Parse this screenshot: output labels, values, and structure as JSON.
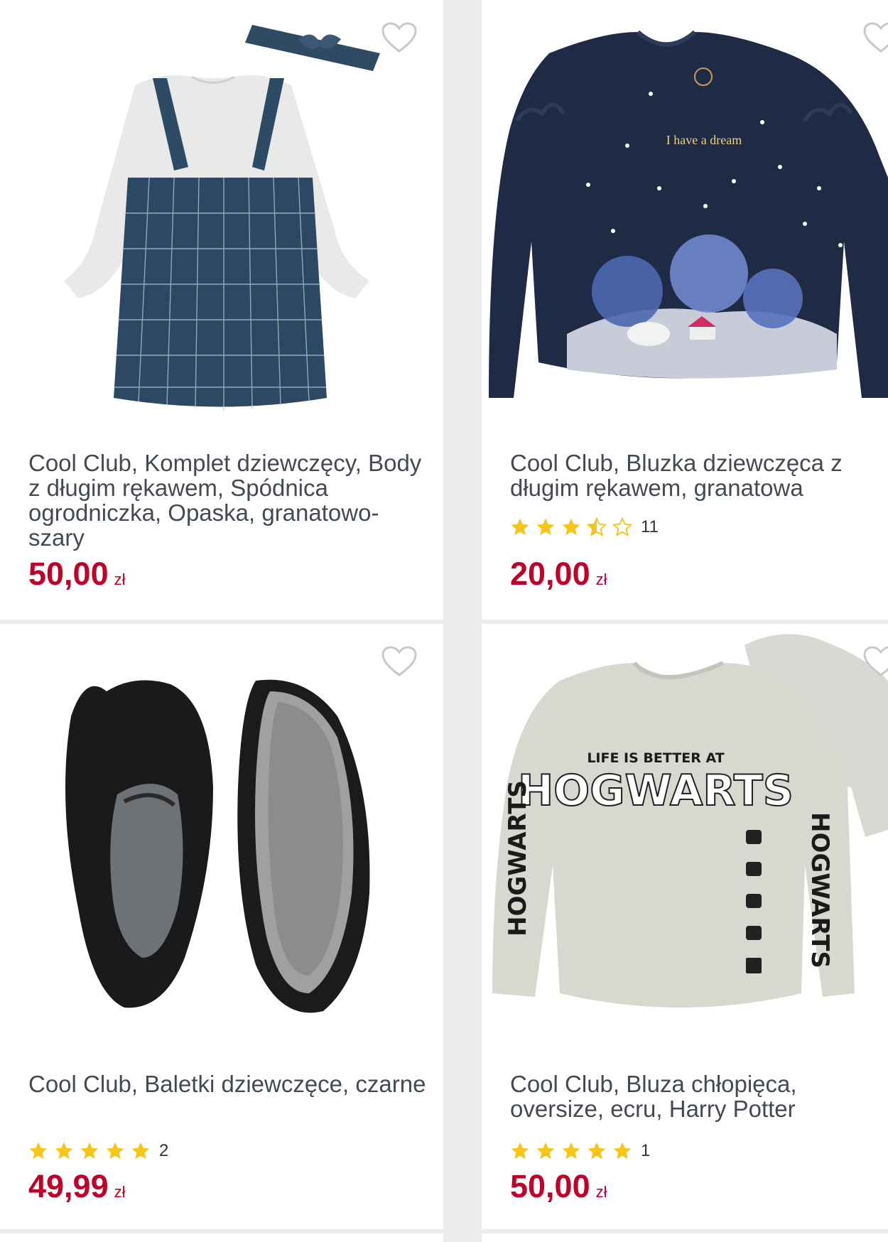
{
  "products": [
    {
      "title": "Cool Club, Komplet dziewczęcy, Body z długim rękawem, Spódnica ogrodniczka, Opaska, granatowo-szary",
      "price": "50,00",
      "currency": "zł",
      "rating": null,
      "review_count": ""
    },
    {
      "title": "Cool Club, Bluzka dziewczęca z długim rękawem, granatowa",
      "price": "20,00",
      "currency": "zł",
      "rating": 3.5,
      "review_count": "11",
      "image_text": "I have a dream"
    },
    {
      "title": "Cool Club, Baletki dziewczęce, czarne",
      "price": "49,99",
      "currency": "zł",
      "rating": 5,
      "review_count": "2"
    },
    {
      "title": "Cool Club, Bluza chłopięca, oversize, ecru, Harry Potter",
      "price": "50,00",
      "currency": "zł",
      "rating": 5,
      "review_count": "1",
      "image_text": {
        "line1": "LIFE IS BETTER AT",
        "line2": "HOGWARTS",
        "sleeve": "HOGWARTS"
      }
    }
  ],
  "colors": {
    "price": "#c0002a",
    "star": "#f5c518",
    "background": "#ececec"
  },
  "icons": [
    "heart-outline-icon",
    "star-icon"
  ]
}
